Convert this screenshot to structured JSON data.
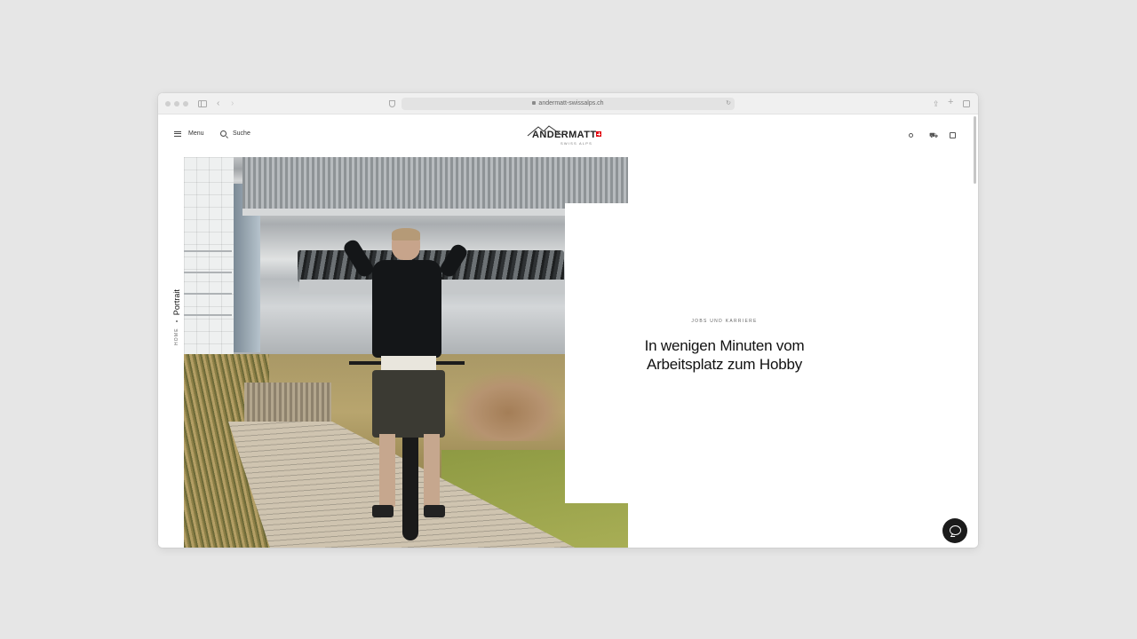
{
  "browser": {
    "url": "andermatt-swissalps.ch"
  },
  "header": {
    "menu_label": "Menu",
    "search_label": "Suche",
    "logo_text": "ANDERMATT",
    "logo_subtext": "SWISS ALPS"
  },
  "breadcrumb": {
    "home": "HOME",
    "current": "Portrait"
  },
  "hero": {
    "eyebrow": "JOBS UND KARRIERE",
    "headline_line1": "In wenigen Minuten vom",
    "headline_line2": "Arbeitsplatz zum Hobby"
  },
  "colors": {
    "accent_flag": "#e30613",
    "chat_button": "#1b1b1b",
    "page_background": "#e6e6e6"
  },
  "icons": {
    "chat": "chat-bubble-icon",
    "weather": "sun-icon",
    "cart": "cart-icon",
    "profile": "profile-icon"
  }
}
